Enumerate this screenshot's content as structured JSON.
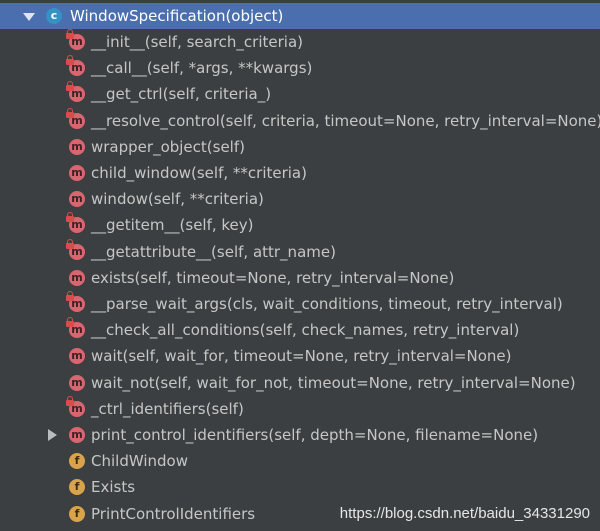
{
  "header": {
    "title": "WindowSpecification(object)",
    "icon": "class-icon",
    "icon_letter": "c"
  },
  "icon_letters": {
    "method": "m",
    "field": "f"
  },
  "members": [
    {
      "label": "__init__(self, search_criteria)",
      "kind": "method",
      "private": true
    },
    {
      "label": "__call__(self, *args, **kwargs)",
      "kind": "method",
      "private": true
    },
    {
      "label": "__get_ctrl(self, criteria_)",
      "kind": "method",
      "private": true
    },
    {
      "label": "__resolve_control(self, criteria, timeout=None, retry_interval=None)",
      "kind": "method",
      "private": true
    },
    {
      "label": "wrapper_object(self)",
      "kind": "method",
      "private": false
    },
    {
      "label": "child_window(self, **criteria)",
      "kind": "method",
      "private": false
    },
    {
      "label": "window(self, **criteria)",
      "kind": "method",
      "private": false
    },
    {
      "label": "__getitem__(self, key)",
      "kind": "method",
      "private": true
    },
    {
      "label": "__getattribute__(self, attr_name)",
      "kind": "method",
      "private": true
    },
    {
      "label": "exists(self, timeout=None, retry_interval=None)",
      "kind": "method",
      "private": false
    },
    {
      "label": "__parse_wait_args(cls, wait_conditions, timeout, retry_interval)",
      "kind": "method",
      "private": true
    },
    {
      "label": "__check_all_conditions(self, check_names, retry_interval)",
      "kind": "method",
      "private": true
    },
    {
      "label": "wait(self, wait_for, timeout=None, retry_interval=None)",
      "kind": "method",
      "private": false
    },
    {
      "label": "wait_not(self, wait_for_not, timeout=None, retry_interval=None)",
      "kind": "method",
      "private": false
    },
    {
      "label": "_ctrl_identifiers(self)",
      "kind": "method",
      "private": true
    },
    {
      "label": "print_control_identifiers(self, depth=None, filename=None)",
      "kind": "method",
      "private": false,
      "expandable": true
    },
    {
      "label": "ChildWindow",
      "kind": "field",
      "private": false
    },
    {
      "label": "Exists",
      "kind": "field",
      "private": false
    },
    {
      "label": "PrintControlIdentifiers",
      "kind": "field",
      "private": false
    }
  ],
  "watermark": "https://blog.csdn.net/baidu_34331290",
  "colors": {
    "background": "#3c3f41",
    "selection": "#4b6eaf",
    "method_icon": "#d9666f",
    "field_icon": "#d8a34a",
    "class_icon": "#3592c4",
    "lock": "#d94c4c"
  }
}
